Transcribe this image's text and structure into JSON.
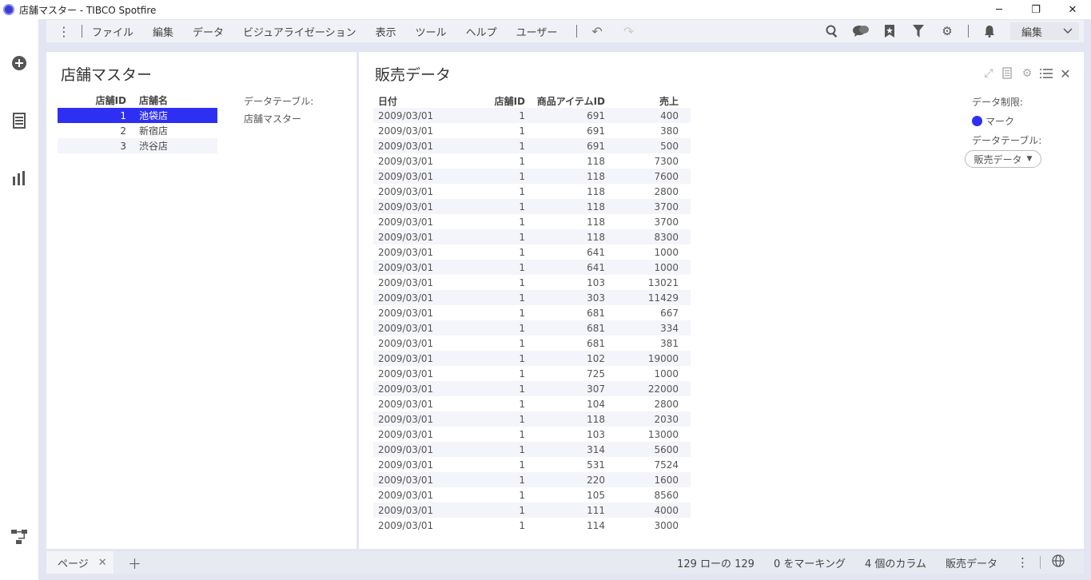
{
  "window": {
    "title": "店舗マスター - TIBCO Spotfire",
    "minimize_icon": "─",
    "restore_icon": "❐",
    "close_icon": "✕"
  },
  "menu": {
    "items": [
      "ファイル",
      "編集",
      "データ",
      "ビジュアライゼーション",
      "表示",
      "ツール",
      "ヘルプ",
      "ユーザー"
    ],
    "mode_label": "編集"
  },
  "left_panel": {
    "title": "店舗マスター",
    "columns": [
      "店舗ID",
      "店舗名"
    ],
    "rows": [
      {
        "id": "1",
        "name": "池袋店"
      },
      {
        "id": "2",
        "name": "新宿店"
      },
      {
        "id": "3",
        "name": "渋谷店"
      }
    ],
    "selected_row": 0,
    "data_table_label": "データテーブル:",
    "data_table_value": "店舗マスター"
  },
  "right_panel": {
    "title": "販売データ",
    "columns": [
      "日付",
      "店舗ID",
      "商品アイテムID",
      "売上"
    ],
    "rows": [
      [
        "2009/03/01",
        "1",
        "691",
        "400"
      ],
      [
        "2009/03/01",
        "1",
        "691",
        "380"
      ],
      [
        "2009/03/01",
        "1",
        "691",
        "500"
      ],
      [
        "2009/03/01",
        "1",
        "118",
        "7300"
      ],
      [
        "2009/03/01",
        "1",
        "118",
        "7600"
      ],
      [
        "2009/03/01",
        "1",
        "118",
        "2800"
      ],
      [
        "2009/03/01",
        "1",
        "118",
        "3700"
      ],
      [
        "2009/03/01",
        "1",
        "118",
        "3700"
      ],
      [
        "2009/03/01",
        "1",
        "118",
        "8300"
      ],
      [
        "2009/03/01",
        "1",
        "641",
        "1000"
      ],
      [
        "2009/03/01",
        "1",
        "641",
        "1000"
      ],
      [
        "2009/03/01",
        "1",
        "103",
        "13021"
      ],
      [
        "2009/03/01",
        "1",
        "303",
        "11429"
      ],
      [
        "2009/03/01",
        "1",
        "681",
        "667"
      ],
      [
        "2009/03/01",
        "1",
        "681",
        "334"
      ],
      [
        "2009/03/01",
        "1",
        "681",
        "381"
      ],
      [
        "2009/03/01",
        "1",
        "102",
        "19000"
      ],
      [
        "2009/03/01",
        "1",
        "725",
        "1000"
      ],
      [
        "2009/03/01",
        "1",
        "307",
        "22000"
      ],
      [
        "2009/03/01",
        "1",
        "104",
        "2800"
      ],
      [
        "2009/03/01",
        "1",
        "118",
        "2030"
      ],
      [
        "2009/03/01",
        "1",
        "103",
        "13000"
      ],
      [
        "2009/03/01",
        "1",
        "314",
        "5600"
      ],
      [
        "2009/03/01",
        "1",
        "531",
        "7524"
      ],
      [
        "2009/03/01",
        "1",
        "220",
        "1600"
      ],
      [
        "2009/03/01",
        "1",
        "105",
        "8560"
      ],
      [
        "2009/03/01",
        "1",
        "111",
        "4000"
      ],
      [
        "2009/03/01",
        "1",
        "114",
        "3000"
      ]
    ],
    "legend": {
      "limit_label": "データ制限:",
      "marking_label": "マーク",
      "marking_color": "#2f2ff4",
      "data_table_label": "データテーブル:",
      "data_table_value": "販売データ"
    }
  },
  "status": {
    "page_tab": "ページ",
    "rows_text": "129 ローの 129",
    "marking_text": "0 をマーキング",
    "columns_text": "4 個のカラム",
    "table_text": "販売データ"
  }
}
